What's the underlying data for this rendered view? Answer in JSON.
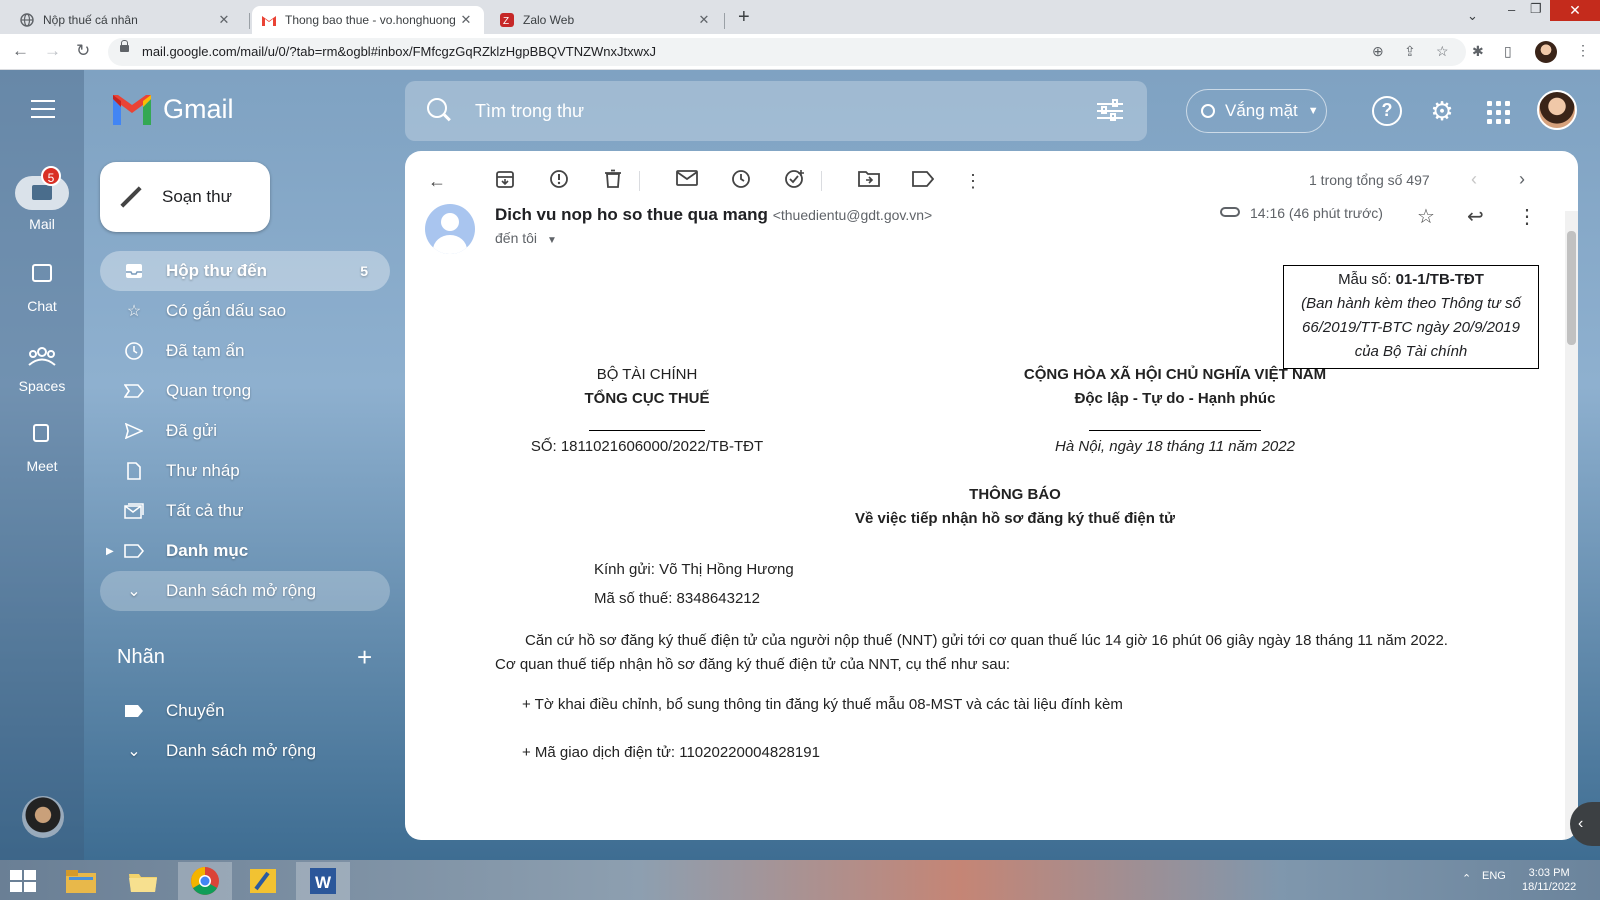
{
  "browser": {
    "tabs": [
      {
        "title": "Nộp thuế cá nhân",
        "active": false
      },
      {
        "title": "Thong bao thue - vo.honghuong",
        "active": true
      },
      {
        "title": "Zalo Web",
        "active": false
      }
    ],
    "url": "mail.google.com/mail/u/0/?tab=rm&ogbl#inbox/FMfcgzGqRZklzHgpBBQVTNZWnxJtxwxJ"
  },
  "gmail": {
    "brand": "Gmail",
    "search_placeholder": "Tìm trong thư",
    "status": "Vắng mặt",
    "rail": [
      {
        "label": "Mail",
        "badge": "5"
      },
      {
        "label": "Chat"
      },
      {
        "label": "Spaces"
      },
      {
        "label": "Meet"
      }
    ],
    "compose_label": "Soạn thư",
    "nav": [
      {
        "label": "Hộp thư đến",
        "count": "5"
      },
      {
        "label": "Có gắn dấu sao"
      },
      {
        "label": "Đã tạm ẩn"
      },
      {
        "label": "Quan trọng"
      },
      {
        "label": "Đã gửi"
      },
      {
        "label": "Thư nháp"
      },
      {
        "label": "Tất cả thư"
      },
      {
        "label": "Danh mục"
      },
      {
        "label": "Danh sách mở rộng"
      }
    ],
    "labels_heading": "Nhãn",
    "labels": [
      {
        "label": "Chuyển"
      },
      {
        "label": "Danh sách mở rộng"
      }
    ],
    "pagination": "1 trong tổng số 497"
  },
  "email": {
    "sender_name": "Dich vu nop ho so thue qua mang",
    "sender_email": "<thuedientu@gdt.gov.vn>",
    "to": "đến tôi",
    "time": "14:16 (46 phút trước)",
    "form": {
      "number_label": "Mẫu số:",
      "number": "01-1/TB-TĐT",
      "line1": "(Ban hành kèm theo Thông tư số",
      "line2": "66/2019/TT-BTC ngày 20/9/2019",
      "line3": "của Bộ Tài chính"
    },
    "ministry": "BỘ TÀI CHÍNH",
    "department": "TỔNG CỤC THUẾ",
    "doc_number": "SỐ: 1811021606000/2022/TB-TĐT",
    "nation": "CỘNG HÒA XÃ HỘI CHỦ NGHĨA VIỆT NAM",
    "motto": "Độc lập - Tự do - Hạnh phúc",
    "place_date": "Hà Nội, ngày 18 tháng 11 năm 2022",
    "doc_title": "THÔNG BÁO",
    "doc_subject": "Về việc tiếp nhận hồ sơ đăng ký thuế điện tử",
    "recipient": "Kính gửi: Võ Thị Hồng Hương",
    "tax_code": "Mã số thuế: 8348643212",
    "para1": "Căn cứ hồ sơ đăng ký thuế điện tử của người nộp thuế (NNT) gửi tới cơ quan thuế lúc 14 giờ 16 phút 06 giây ngày 18 tháng 11 năm 2022.",
    "para2": "Cơ quan thuế tiếp nhận hồ sơ đăng ký thuế điện tử của NNT, cụ thể như sau:",
    "item1": "+ Tờ khai điều chỉnh, bổ sung thông tin đăng ký thuế mẫu 08-MST và các tài liệu đính kèm",
    "item2": "+ Mã giao dịch điện tử: 11020220004828191"
  },
  "taskbar": {
    "lang": "ENG",
    "time": "3:03 PM",
    "date": "18/11/2022"
  }
}
